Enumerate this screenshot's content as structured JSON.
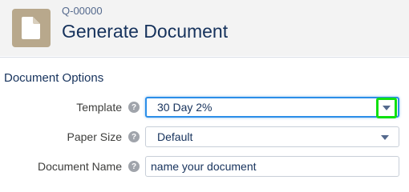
{
  "header": {
    "record_id": "Q-00000",
    "title": "Generate Document",
    "icon": "document-icon"
  },
  "section": {
    "title": "Document Options"
  },
  "fields": {
    "template": {
      "label": "Template",
      "value": "30 Day 2%",
      "help_icon": "help-icon"
    },
    "paper_size": {
      "label": "Paper Size",
      "value": "Default",
      "help_icon": "help-icon"
    },
    "document_name": {
      "label": "Document Name",
      "value": "name your document",
      "help_icon": "help-icon"
    }
  },
  "colors": {
    "header_bg": "#f3f3f3",
    "icon_bg": "#b8a88c",
    "title_text": "#16325c",
    "focus_border": "#2b8ee8",
    "highlight": "#10e010",
    "caret": "#54698d"
  }
}
